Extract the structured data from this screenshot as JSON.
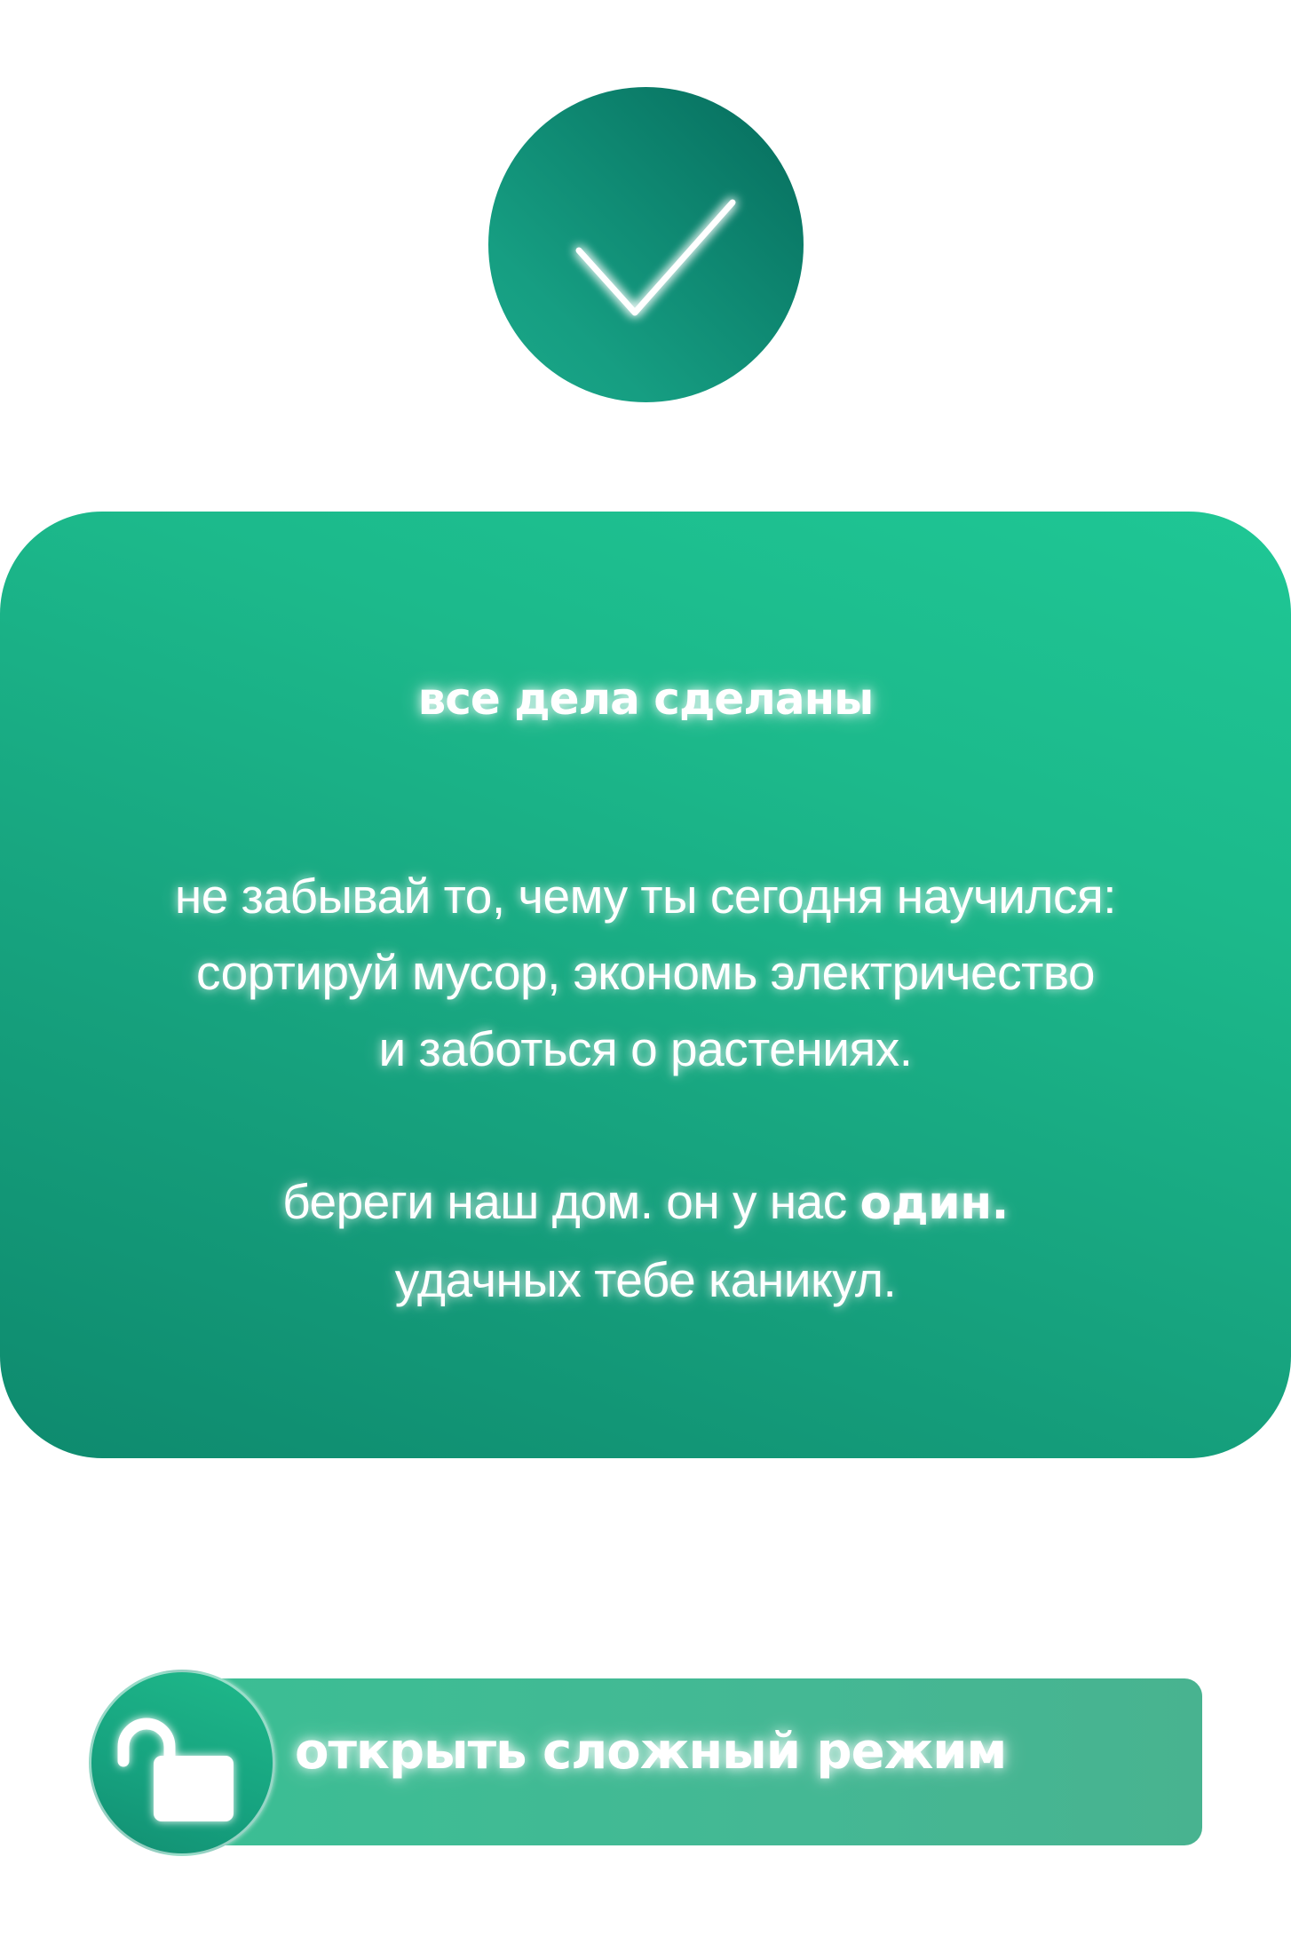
{
  "success_badge": {
    "icon": "checkmark-icon",
    "color_dark": "#066b5c",
    "color_light": "#1aa888"
  },
  "card": {
    "title": "все дела сделаны",
    "lines": [
      "не забывай то, чему ты сегодня научился:",
      "сортируй мусор, экономь электричество",
      "и заботься о растениях."
    ],
    "closing_prefix": "береги наш дом. он у нас ",
    "closing_bold": "один.",
    "farewell": "удачных тебе каникул.",
    "color_top": "#1fc795",
    "color_bottom": "#0e8a6e"
  },
  "hard_mode_button": {
    "label": "открыть сложный режим",
    "icon": "unlocked-padlock-icon",
    "bar_color": "#44b894"
  }
}
